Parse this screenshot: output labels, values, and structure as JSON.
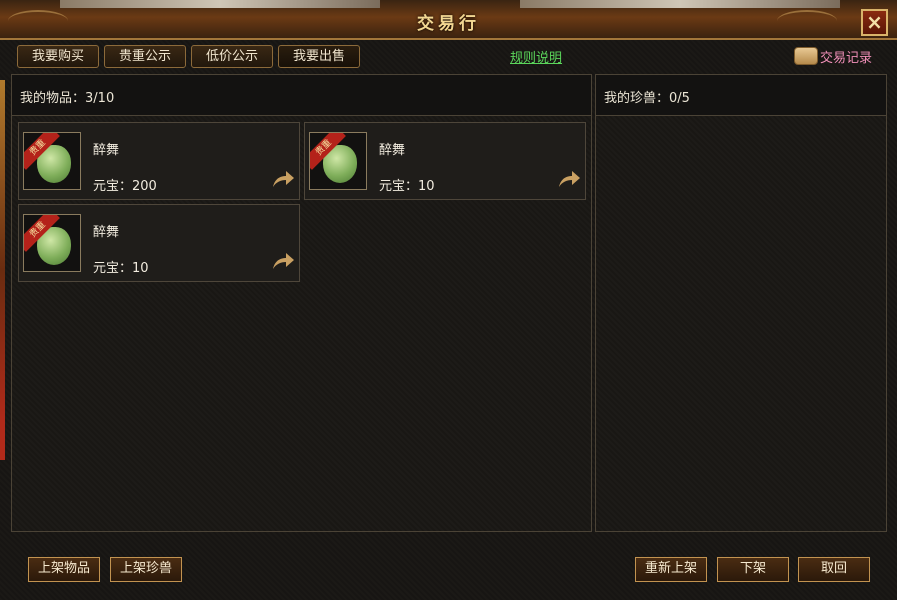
{
  "window": {
    "title": "交易行",
    "close_icon": "×"
  },
  "tabs": {
    "buy": "我要购买",
    "valuable": "贵重公示",
    "lowprice": "低价公示",
    "sell": "我要出售"
  },
  "rules_link": "规则说明",
  "trade_record": {
    "label": "交易记录",
    "icon": "scroll-icon"
  },
  "items_panel": {
    "label": "我的物品：",
    "count": "3/10"
  },
  "pets_panel": {
    "label": "我的珍兽：",
    "count": "0/5"
  },
  "items": [
    {
      "name": "醉舞",
      "price_label": "元宝：",
      "price": "200",
      "badge": "贵重",
      "icon": "jade-pendant-icon"
    },
    {
      "name": "醉舞",
      "price_label": "元宝：",
      "price": "10",
      "badge": "贵重",
      "icon": "jade-pendant-icon"
    },
    {
      "name": "醉舞",
      "price_label": "元宝：",
      "price": "10",
      "badge": "贵重",
      "icon": "jade-pendant-icon"
    }
  ],
  "buttons": {
    "list_item": "上架物品",
    "list_pet": "上架珍兽",
    "relist": "重新上架",
    "delist": "下架",
    "cancel": "取回"
  },
  "colors": {
    "title": "#f2d792",
    "rules_link": "#5bd65b",
    "trade_record": "#f08fb8",
    "button_border": "#c29350"
  }
}
